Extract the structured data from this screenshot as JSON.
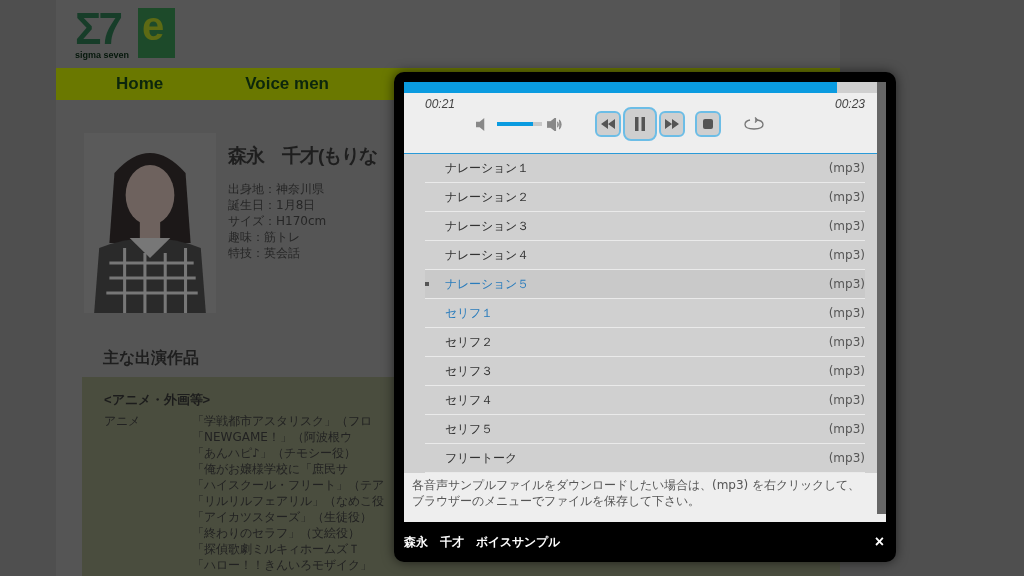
{
  "logo": {
    "mark": "Σ7",
    "badge": "e",
    "caption": "sigma seven"
  },
  "nav": [
    "Home",
    "Voice men"
  ],
  "profile": {
    "name": "森永　千才(もりな",
    "facts": [
      "出身地：神奈川県",
      "誕生日：1月8日",
      "サイズ：H170cm",
      "趣味：筋トレ",
      "特技：英会話"
    ]
  },
  "works": {
    "heading": "主な出演作品",
    "section": "<アニメ・外画等>",
    "category": "アニメ",
    "items": [
      "「学戦都市アスタリスク」（フロ",
      "「NEWGAME！」（阿波根ウ",
      "「あんハピ♪」（チモシー役）",
      "「俺がお嬢様学校に「庶民サ",
      "「ハイスクール・フリート」（テア",
      "「リルリルフェアリル」（なめこ役",
      "「アイカツスターズ」（生徒役）",
      "「終わりのセラフ」（文絵役）",
      "「探偵歌劇ミルキィホームズＴ",
      "「ハロー！！きんいろモザイク」"
    ]
  },
  "player": {
    "elapsed": "00:21",
    "duration": "00:23",
    "progress": {
      "level": 0.915
    },
    "volume": {
      "level": 0.8
    },
    "playing": true,
    "tracks": [
      {
        "name": "ナレーション１",
        "format": "(mp3)",
        "selected": false,
        "highlighted": false
      },
      {
        "name": "ナレーション２",
        "format": "(mp3)",
        "selected": false,
        "highlighted": false
      },
      {
        "name": "ナレーション３",
        "format": "(mp3)",
        "selected": false,
        "highlighted": false
      },
      {
        "name": "ナレーション４",
        "format": "(mp3)",
        "selected": false,
        "highlighted": false
      },
      {
        "name": "ナレーション５",
        "format": "(mp3)",
        "selected": true,
        "highlighted": true
      },
      {
        "name": "セリフ１",
        "format": "(mp3)",
        "selected": false,
        "highlighted": true
      },
      {
        "name": "セリフ２",
        "format": "(mp3)",
        "selected": false,
        "highlighted": false
      },
      {
        "name": "セリフ３",
        "format": "(mp3)",
        "selected": false,
        "highlighted": false
      },
      {
        "name": "セリフ４",
        "format": "(mp3)",
        "selected": false,
        "highlighted": false
      },
      {
        "name": "セリフ５",
        "format": "(mp3)",
        "selected": false,
        "highlighted": false
      },
      {
        "name": "フリートーク",
        "format": "(mp3)",
        "selected": false,
        "highlighted": false
      }
    ],
    "note": "各音声サンプルファイルをダウンロードしたい場合は、(mp3) を右クリックして、ブラウザーのメニューでファイルを保存して下さい。"
  },
  "lightbox": {
    "title": "森永　千才　ボイスサンプル",
    "close": "×"
  }
}
